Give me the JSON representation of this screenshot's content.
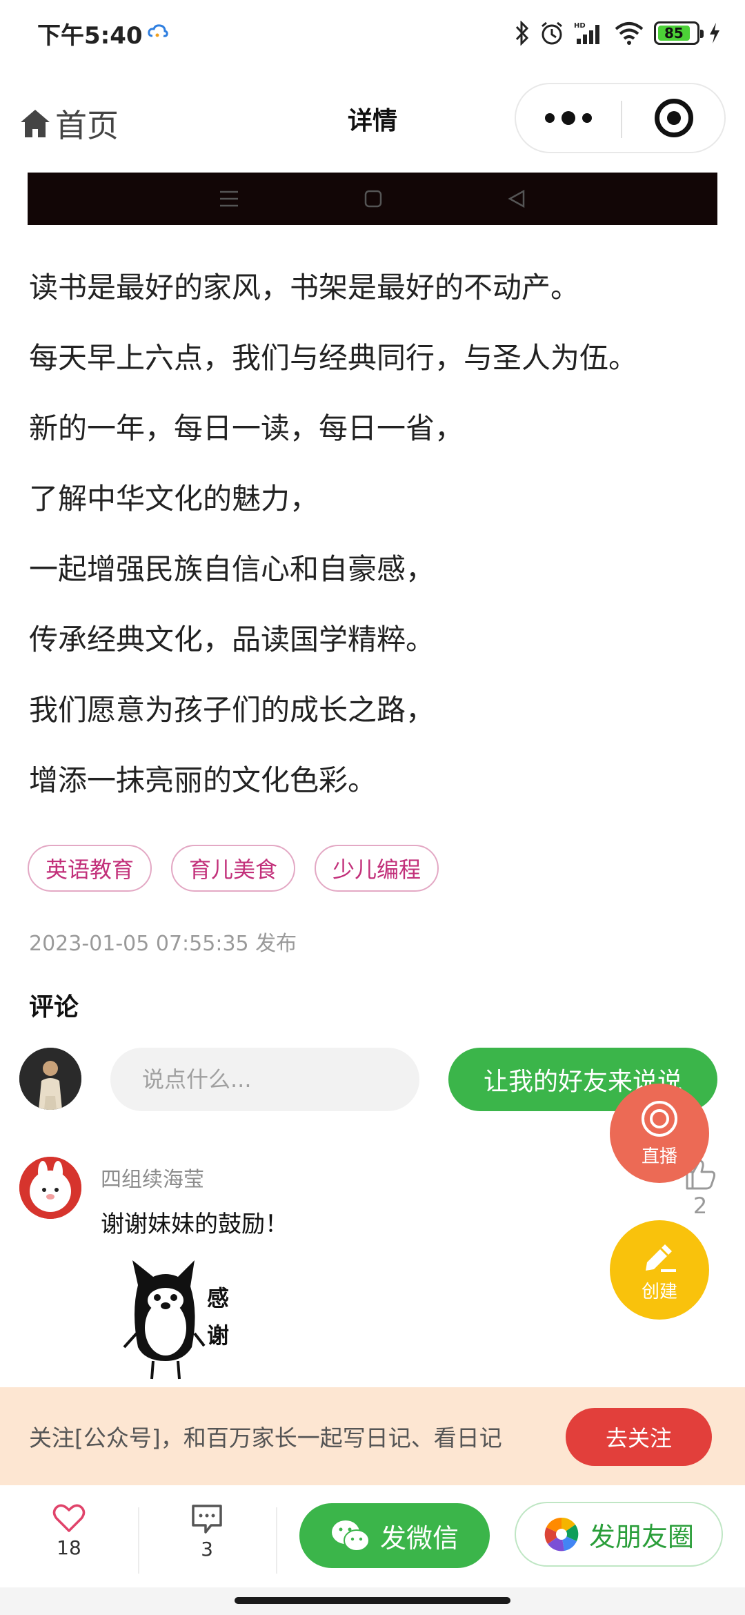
{
  "status_bar": {
    "time": "下午5:40",
    "battery": "85",
    "battery_level_percent": 85,
    "icons": [
      "cloud-sync-icon",
      "bluetooth-icon",
      "alarm-icon",
      "signal-icon",
      "wifi-icon",
      "battery-icon",
      "charging-icon"
    ]
  },
  "nav": {
    "home_label": "首页",
    "title": "详情"
  },
  "article": {
    "lines": [
      "读书是最好的家风，书架是最好的不动产。",
      "每天早上六点，我们与经典同行，与圣人为伍。",
      "新的一年，每日一读，每日一省，",
      "了解中华文化的魅力，",
      "一起增强民族自信心和自豪感，",
      "传承经典文化，品读国学精粹。",
      "我们愿意为孩子们的成长之路，",
      "增添一抹亮丽的文化色彩。"
    ]
  },
  "tags": [
    "英语教育",
    "育儿美食",
    "少儿编程"
  ],
  "publish_time": "2023-01-05 07:55:35 发布",
  "comments": {
    "heading": "评论",
    "input_placeholder": "说点什么...",
    "friend_button": "让我的好友来说说",
    "items": [
      {
        "author": "四组续海莹",
        "text": "谢谢妹妹的鼓励！",
        "sticker_text": [
          "感",
          "谢"
        ],
        "likes": "2"
      }
    ]
  },
  "fab": {
    "live_label": "直播",
    "create_label": "创建"
  },
  "follow": {
    "text": "关注[公众号]，和百万家长一起写日记、看日记",
    "button": "去关注"
  },
  "bottom_bar": {
    "likes": "18",
    "comments": "3",
    "wechat_button": "发微信",
    "moments_button": "发朋友圈"
  },
  "colors": {
    "green": "#3bb54a",
    "tag_pink": "#c2307a",
    "live_red": "#ec6a55",
    "create_yellow": "#f9c20c",
    "follow_bg": "#fde6d2",
    "follow_button": "#e23f3b"
  }
}
